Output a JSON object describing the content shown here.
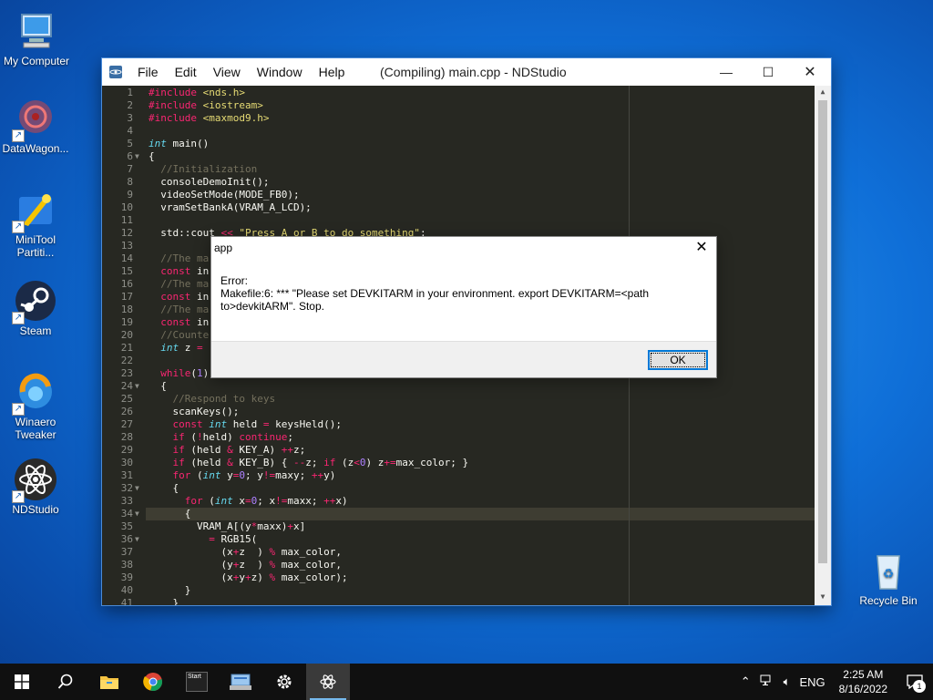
{
  "desktop": {
    "icons": [
      {
        "label": "My Computer",
        "icon": "computer-icon"
      },
      {
        "label": "DataWagon...",
        "icon": "datawagon-icon"
      },
      {
        "label": "MiniTool Partiti...",
        "icon": "minitool-icon"
      },
      {
        "label": "Steam",
        "icon": "steam-icon"
      },
      {
        "label": "Winaero Tweaker",
        "icon": "winaero-icon"
      },
      {
        "label": "NDStudio",
        "icon": "ndstudio-icon"
      },
      {
        "label": "Recycle Bin",
        "icon": "recycle-bin-icon"
      }
    ]
  },
  "window": {
    "title": "(Compiling) main.cpp - NDStudio",
    "menu": [
      "File",
      "Edit",
      "View",
      "Window",
      "Help"
    ],
    "controls": {
      "minimize": "—",
      "maximize": "☐",
      "close": "✕"
    }
  },
  "editor": {
    "current_line": 34,
    "lines": [
      "#include <nds.h>",
      "#include <iostream>",
      "#include <maxmod9.h>",
      "",
      "int main()",
      "{",
      "  //Initialization",
      "  consoleDemoInit();",
      "  videoSetMode(MODE_FB0);",
      "  vramSetBankA(VRAM_A_LCD);",
      "",
      "  std::cout << \"Press A or B to do something\";",
      "",
      "  //The ma",
      "  const in",
      "  //The ma",
      "  const in",
      "  //The ma",
      "  const in",
      "  //Counte",
      "  int z = ",
      "",
      "  while(1)",
      "  {",
      "    //Respond to keys",
      "    scanKeys();",
      "    const int held = keysHeld();",
      "    if (!held) continue;",
      "    if (held & KEY_A) ++z;",
      "    if (held & KEY_B) { --z; if (z<0) z+=max_color; }",
      "    for (int y=0; y!=maxy; ++y)",
      "    {",
      "      for (int x=0; x!=maxx; ++x)",
      "      {",
      "        VRAM_A[(y*maxx)+x]",
      "          = RGB15(",
      "            (x+z  ) % max_color,",
      "            (y+z  ) % max_color,",
      "            (x+y+z) % max_color);",
      "      }",
      "    }"
    ]
  },
  "dialog": {
    "title": "app",
    "close": "✕",
    "message_line1": "Error:",
    "message_line2": "Makefile:6: *** \"Please set DEVKITARM in your environment. export DEVKITARM=<path",
    "message_line3": "to>devkitARM\".  Stop.",
    "ok_label": "OK"
  },
  "taskbar": {
    "items": [
      "start-icon",
      "search-icon",
      "file-explorer-icon",
      "chrome-icon",
      "start-app-icon",
      "control-panel-icon",
      "settings-icon",
      "ndstudio-icon"
    ],
    "start_app_label": "Start",
    "language": "ENG",
    "time": "2:25 AM",
    "date": "8/16/2022",
    "notification_count": "1"
  }
}
